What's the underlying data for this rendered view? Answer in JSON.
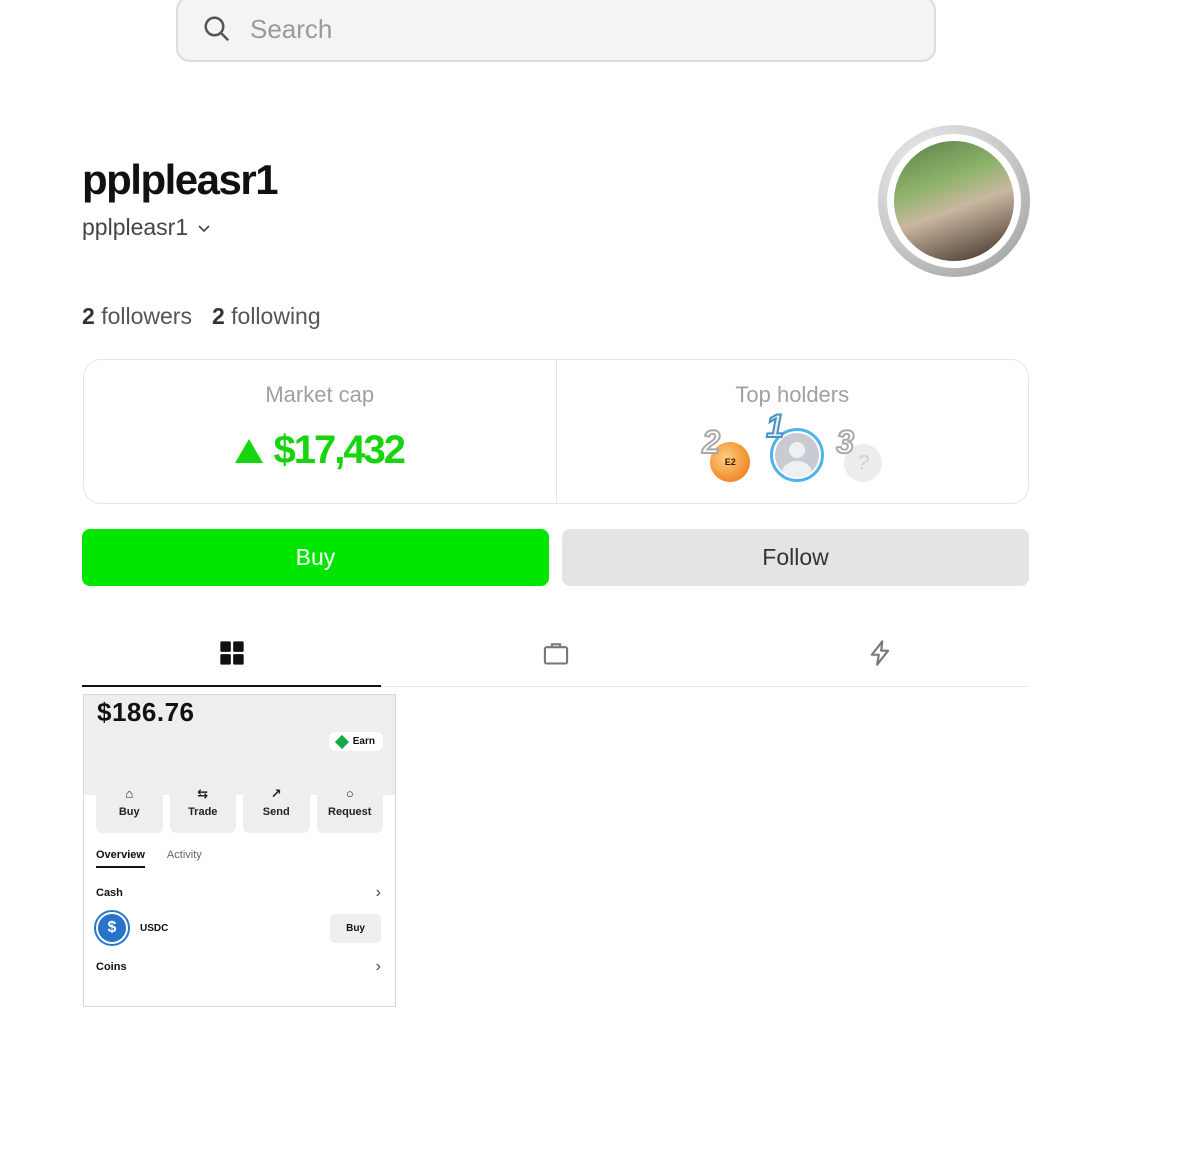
{
  "search": {
    "placeholder": "Search"
  },
  "profile": {
    "display_name": "pplpleasr1",
    "username": "pplpleasr1",
    "followers_count": "2",
    "followers_label": "followers",
    "following_count": "2",
    "following_label": "following"
  },
  "stats": {
    "market_cap_label": "Market cap",
    "market_cap_value": "$17,432",
    "top_holders_label": "Top holders",
    "holders": [
      {
        "rank": "2",
        "badge": "E2"
      },
      {
        "rank": "1"
      },
      {
        "rank": "3",
        "badge": "?"
      }
    ]
  },
  "actions": {
    "buy_label": "Buy",
    "follow_label": "Follow"
  },
  "tabs": [
    {
      "icon": "grid-icon",
      "active": true
    },
    {
      "icon": "bag-icon",
      "active": false
    },
    {
      "icon": "lightning-icon",
      "active": false
    }
  ],
  "post": {
    "balance": "$186.76",
    "earn_label": "Earn",
    "actions": [
      {
        "label": "Buy",
        "icon": "bank-icon"
      },
      {
        "label": "Trade",
        "icon": "swap-icon"
      },
      {
        "label": "Send",
        "icon": "arrow-up-right-icon"
      },
      {
        "label": "Request",
        "icon": "person-icon"
      }
    ],
    "tab_overview": "Overview",
    "tab_activity": "Activity",
    "cash_label": "Cash",
    "usdc_label": "USDC",
    "usdc_buy": "Buy",
    "coins_label": "Coins"
  },
  "colors": {
    "accent_green": "#00e600",
    "market_cap_green": "#16d40e"
  }
}
